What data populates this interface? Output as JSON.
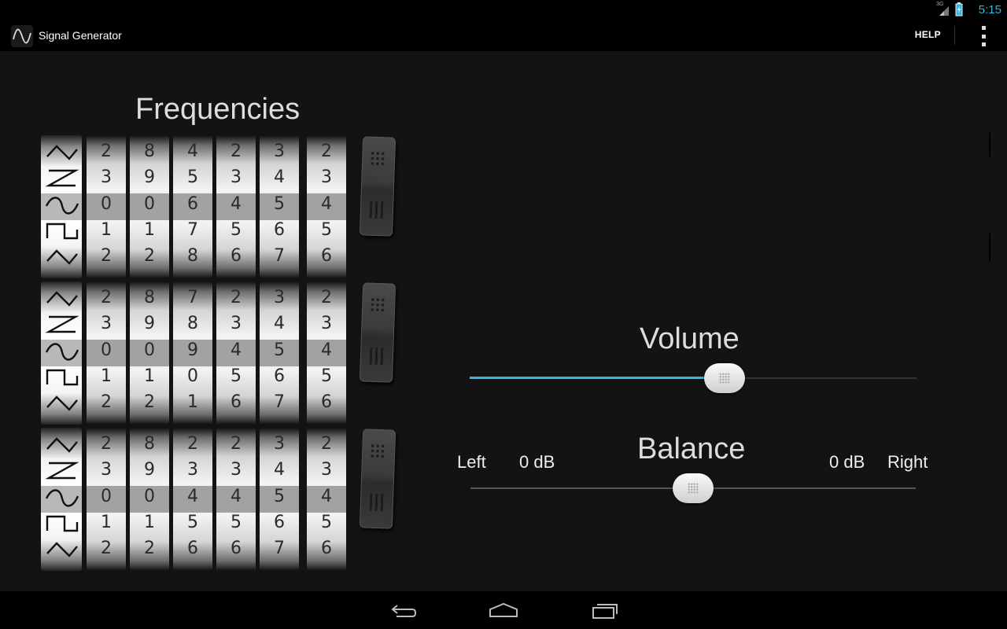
{
  "status_bar": {
    "network": "3G",
    "time": "5:15"
  },
  "action_bar": {
    "title": "Signal Generator",
    "help_label": "HELP",
    "overflow_icon": "overflow-menu-icon"
  },
  "frequencies": {
    "title": "Frequencies",
    "banks": [
      {
        "waveforms": [
          "triangle",
          "sawtooth",
          "sine",
          "square",
          "triangle"
        ],
        "selected_waveform": "sine",
        "columns": [
          [
            "2",
            "3",
            "0",
            "1",
            "2"
          ],
          [
            "8",
            "9",
            "0",
            "1",
            "2"
          ],
          [
            "4",
            "5",
            "6",
            "7",
            "8"
          ],
          [
            "2",
            "3",
            "4",
            "5",
            "6"
          ],
          [
            "3",
            "4",
            "5",
            "6",
            "7"
          ],
          [
            "2",
            "3",
            "4",
            "5",
            "6"
          ]
        ]
      },
      {
        "waveforms": [
          "triangle",
          "sawtooth",
          "sine",
          "square",
          "triangle"
        ],
        "selected_waveform": "sine",
        "columns": [
          [
            "2",
            "3",
            "0",
            "1",
            "2"
          ],
          [
            "8",
            "9",
            "0",
            "1",
            "2"
          ],
          [
            "7",
            "8",
            "9",
            "0",
            "1"
          ],
          [
            "2",
            "3",
            "4",
            "5",
            "6"
          ],
          [
            "3",
            "4",
            "5",
            "6",
            "7"
          ],
          [
            "2",
            "3",
            "4",
            "5",
            "6"
          ]
        ]
      },
      {
        "waveforms": [
          "triangle",
          "sawtooth",
          "sine",
          "square",
          "triangle"
        ],
        "selected_waveform": "sine",
        "columns": [
          [
            "2",
            "3",
            "0",
            "1",
            "2"
          ],
          [
            "8",
            "9",
            "0",
            "1",
            "2"
          ],
          [
            "2",
            "3",
            "4",
            "5",
            "6"
          ],
          [
            "2",
            "3",
            "4",
            "5",
            "6"
          ],
          [
            "3",
            "4",
            "5",
            "6",
            "7"
          ],
          [
            "2",
            "3",
            "4",
            "5",
            "6"
          ]
        ]
      }
    ]
  },
  "volume": {
    "title": "Volume",
    "level": 0.57
  },
  "balance": {
    "title": "Balance",
    "left_label": "Left",
    "left_db": "0 dB",
    "right_db": "0 dB",
    "right_label": "Right",
    "level": 0.5
  },
  "colors": {
    "accent": "#33b5e5",
    "background": "#131313"
  },
  "nav_bar": {
    "icons": [
      "back-icon",
      "home-icon",
      "recent-apps-icon"
    ]
  }
}
